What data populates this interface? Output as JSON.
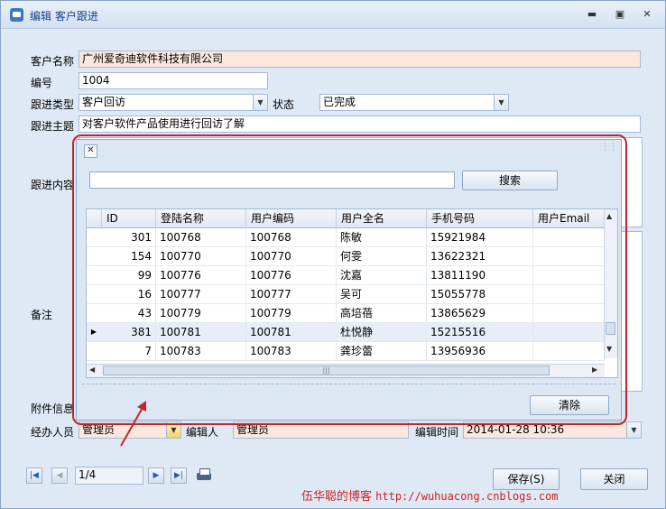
{
  "window": {
    "title": "编辑 客户跟进"
  },
  "form": {
    "customer_name_label": "客户名称",
    "customer_name": "广州爱奇迪软件科技有限公司",
    "number_label": "编号",
    "number": "1004",
    "type_label": "跟进类型",
    "type": "客户回访",
    "status_label": "状态",
    "status": "已完成",
    "topic_label": "跟进主题",
    "topic": "对客户软件产品使用进行回访了解",
    "content_label": "跟进内容",
    "remark_label": "备注",
    "attachment_label": "附件信息",
    "handler_label": "经办人员",
    "handler": "管理员",
    "editor_label": "编辑人",
    "editor": "管理员",
    "edit_time_label": "编辑时间",
    "edit_time": "2014-01-28 10:36"
  },
  "popup": {
    "search_label": "搜索",
    "clear_label": "清除",
    "columns": [
      "ID",
      "登陆名称",
      "用户编码",
      "用户全名",
      "手机号码",
      "用户Email"
    ],
    "rows": [
      {
        "id": "301",
        "login": "100768",
        "code": "100768",
        "name": "陈敏",
        "phone": "15921984",
        "email": ""
      },
      {
        "id": "154",
        "login": "100770",
        "code": "100770",
        "name": "何雯",
        "phone": "13622321",
        "email": ""
      },
      {
        "id": "99",
        "login": "100776",
        "code": "100776",
        "name": "沈嘉",
        "phone": "13811190",
        "email": ""
      },
      {
        "id": "16",
        "login": "100777",
        "code": "100777",
        "name": "吴可",
        "phone": "15055778",
        "email": ""
      },
      {
        "id": "43",
        "login": "100779",
        "code": "100779",
        "name": "高培蓓",
        "phone": "13865629",
        "email": ""
      },
      {
        "id": "381",
        "login": "100781",
        "code": "100781",
        "name": "杜悦静",
        "phone": "15215516",
        "email": ""
      },
      {
        "id": "7",
        "login": "100783",
        "code": "100783",
        "name": "龚珍蕾",
        "phone": "13956936",
        "email": ""
      }
    ]
  },
  "pager": {
    "position": "1/4"
  },
  "buttons": {
    "save": "保存(S)",
    "close": "关闭"
  },
  "watermark": {
    "author": "伍华聪的博客",
    "url": "http://wuhuacong.cnblogs.com"
  }
}
